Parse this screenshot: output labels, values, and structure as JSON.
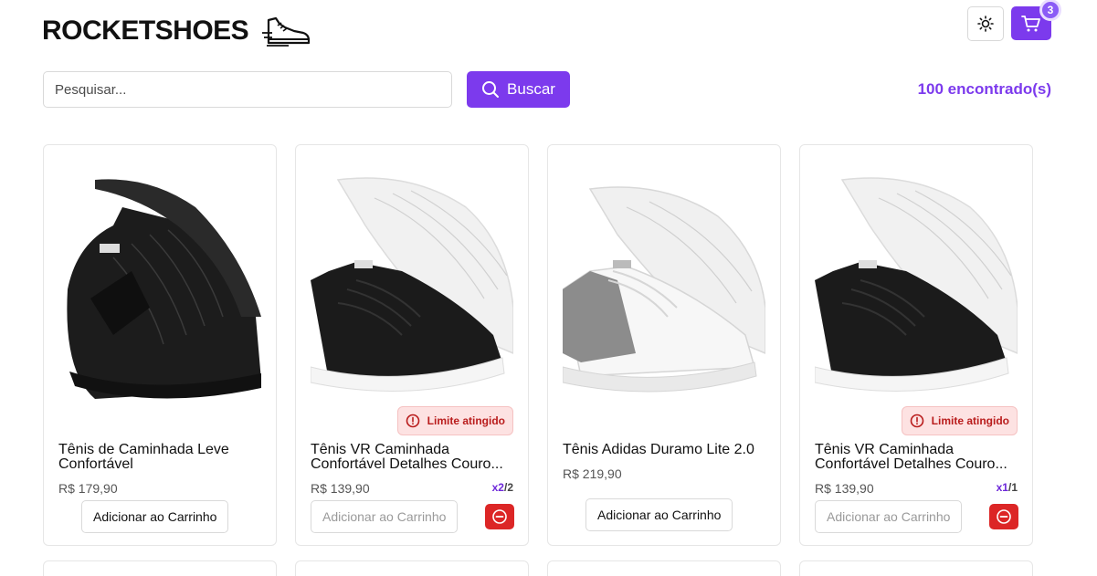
{
  "header": {
    "logo_text": "ROCKETSHOES",
    "cart_count": "3"
  },
  "search": {
    "placeholder": "Pesquisar...",
    "button_label": "Buscar",
    "found_text": "100 encontrado(s)"
  },
  "colors": {
    "accent": "#7c3aed",
    "danger": "#dc2626",
    "limit_bg": "#fde2e2"
  },
  "products": [
    {
      "title_line1": "Tênis de Caminhada Leve",
      "title_line2": "Confortável",
      "price": "R$ 179,90",
      "add_label": "Adicionar ao Carrinho",
      "shoe": "black"
    },
    {
      "title_line1": "Tênis VR Caminhada",
      "title_line2": "Confortável Detalhes Couro...",
      "price": "R$ 139,90",
      "add_label": "Adicionar ao Carrinho",
      "limit_label": "Limite atingido",
      "qty_current": "x2",
      "qty_max": "/2",
      "shoe": "black-white"
    },
    {
      "title_line1": "Tênis Adidas Duramo Lite 2.0",
      "price": "R$ 219,90",
      "add_label": "Adicionar ao Carrinho",
      "shoe": "white-grey"
    },
    {
      "title_line1": "Tênis VR Caminhada",
      "title_line2": "Confortável Detalhes Couro...",
      "price": "R$ 139,90",
      "add_label": "Adicionar ao Carrinho",
      "limit_label": "Limite atingido",
      "qty_current": "x1",
      "qty_max": "/1",
      "shoe": "black-white"
    }
  ]
}
